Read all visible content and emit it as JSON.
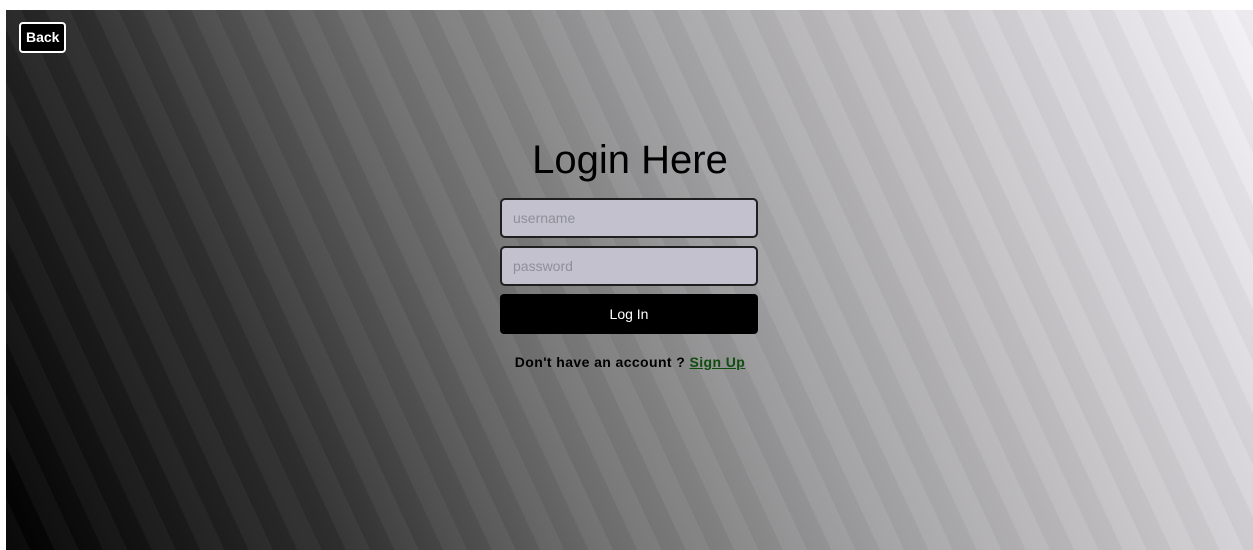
{
  "nav": {
    "back_label": "Back"
  },
  "login": {
    "title": "Login Here",
    "username_placeholder": "username",
    "password_placeholder": "password",
    "submit_label": "Log In",
    "signup_prompt": "Don't have an account ?",
    "signup_link": "Sign Up"
  },
  "colors": {
    "button_bg": "#000000",
    "input_bg": "#c2c1cd",
    "link": "#0e4d0e"
  }
}
